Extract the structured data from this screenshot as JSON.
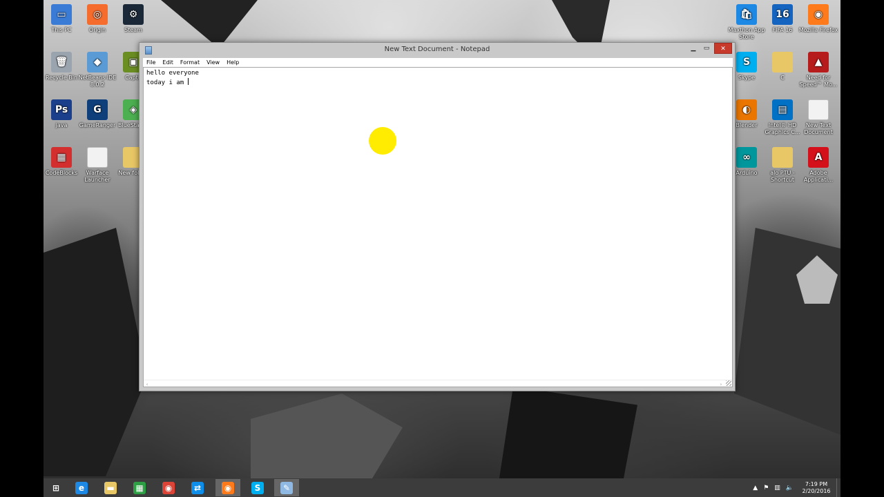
{
  "desktop": {
    "icons_left": [
      {
        "label": "This PC",
        "icon": "computer-icon",
        "color": "#3a7bd5",
        "glyph": "▭"
      },
      {
        "label": "Origin",
        "icon": "origin-icon",
        "color": "#f56c2d",
        "glyph": "◎"
      },
      {
        "label": "Steam",
        "icon": "steam-icon",
        "color": "#1b2838",
        "glyph": "⚙"
      },
      {
        "label": "Recycle Bin",
        "icon": "recycle-bin-icon",
        "color": "#9aa4ae",
        "glyph": "🗑"
      },
      {
        "label": "NetBeans IDE 8.0.2",
        "icon": "netbeans-icon",
        "color": "#5b9bd5",
        "glyph": "◆"
      },
      {
        "label": "Captu",
        "icon": "capture-icon",
        "color": "#6b8e23",
        "glyph": "▣"
      },
      {
        "label": "java",
        "icon": "photoshop-file-icon",
        "color": "#1c3f8c",
        "glyph": "Ps"
      },
      {
        "label": "GameRanger",
        "icon": "gameranger-icon",
        "color": "#0f3f7a",
        "glyph": "G"
      },
      {
        "label": "BlueStacks",
        "icon": "bluestacks-icon",
        "color": "#4caf50",
        "glyph": "◈"
      },
      {
        "label": "CodeBlocks",
        "icon": "codeblocks-icon",
        "color": "#d32f2f",
        "glyph": "▦"
      },
      {
        "label": "Warface Launcher",
        "icon": "file-icon",
        "color": "#f2f2f2",
        "glyph": ""
      },
      {
        "label": "New folder",
        "icon": "folder-icon",
        "color": "#e8c766",
        "glyph": ""
      }
    ],
    "icons_right": [
      {
        "label": "Maxthon App Store",
        "icon": "maxthon-store-icon",
        "color": "#1e88e5",
        "glyph": "🛍"
      },
      {
        "label": "FIFA 16",
        "icon": "fifa-icon",
        "color": "#1565c0",
        "glyph": "16"
      },
      {
        "label": "Mozilla Firefox",
        "icon": "firefox-icon",
        "color": "#ff7a1a",
        "glyph": "◉"
      },
      {
        "label": "Skype",
        "icon": "skype-icon",
        "color": "#00aff0",
        "glyph": "S"
      },
      {
        "label": "C",
        "icon": "folder-icon",
        "color": "#e8c766",
        "glyph": ""
      },
      {
        "label": "Need for Speed™ Mo...",
        "icon": "need-for-speed-icon",
        "color": "#b71c1c",
        "glyph": "▲"
      },
      {
        "label": "Blender",
        "icon": "blender-icon",
        "color": "#ea7600",
        "glyph": "◐"
      },
      {
        "label": "Intel® HD Graphics C...",
        "icon": "intel-graphics-icon",
        "color": "#0071c5",
        "glyph": "▤"
      },
      {
        "label": "New Text Document",
        "icon": "text-document-icon",
        "color": "#f2f2f2",
        "glyph": ""
      },
      {
        "label": "Arduino",
        "icon": "arduino-icon",
        "color": "#00979c",
        "glyph": "∞"
      },
      {
        "label": "alo PTU - Shortcut",
        "icon": "folder-icon",
        "color": "#e8c766",
        "glyph": ""
      },
      {
        "label": "Adobe Applicati...",
        "icon": "adobe-icon",
        "color": "#d4111a",
        "glyph": "A"
      }
    ]
  },
  "notepad": {
    "title": "New Text Document - Notepad",
    "minimize": "▁",
    "maximize": "▭",
    "close": "✕",
    "menus": [
      "File",
      "Edit",
      "Format",
      "View",
      "Help"
    ],
    "lines": [
      "hello everyone",
      "today i am "
    ],
    "scroll_left": "‹",
    "scroll_right": "›"
  },
  "taskbar": {
    "items": [
      {
        "icon": "windows-start-icon",
        "color": "#3c3c3c",
        "glyph": "⊞"
      },
      {
        "icon": "internet-explorer-icon",
        "color": "#1e88e5",
        "glyph": "e"
      },
      {
        "icon": "file-explorer-icon",
        "color": "#e8c766",
        "glyph": "▬"
      },
      {
        "icon": "store-icon",
        "color": "#2e9e44",
        "glyph": "▦"
      },
      {
        "icon": "chrome-icon",
        "color": "#db4437",
        "glyph": "◉"
      },
      {
        "icon": "teamviewer-icon",
        "color": "#0e8ee9",
        "glyph": "⇄"
      },
      {
        "icon": "firefox-icon",
        "color": "#ff7a1a",
        "glyph": "◉"
      },
      {
        "icon": "skype-icon",
        "color": "#00aff0",
        "glyph": "S"
      },
      {
        "icon": "notepad-icon",
        "color": "#8fb9e3",
        "glyph": "✎"
      }
    ],
    "tray": {
      "chevron": "▲",
      "flag": "⚑",
      "network": "▥",
      "volume": "🔈",
      "time": "7:19 PM",
      "date": "2/20/2016"
    }
  }
}
